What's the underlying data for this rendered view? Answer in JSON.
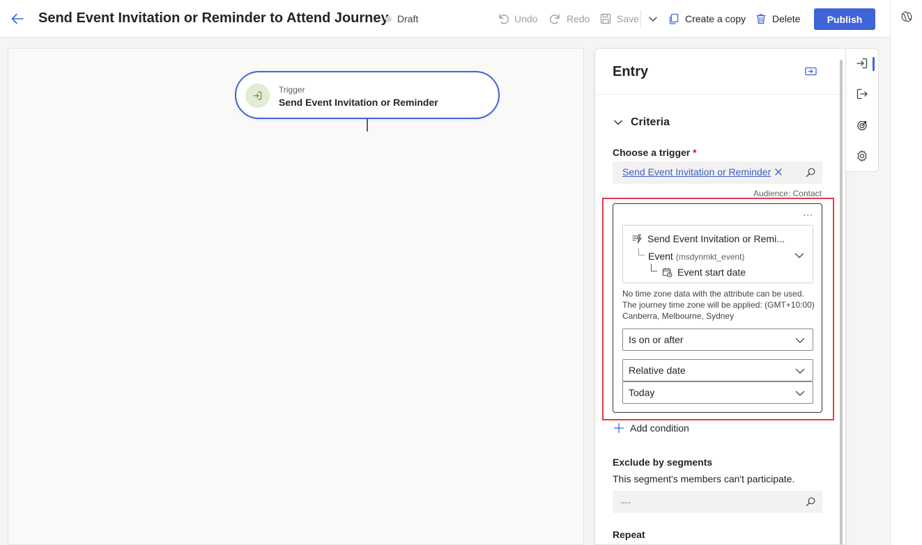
{
  "header": {
    "title": "Send Event Invitation or Reminder to Attend Journey",
    "status": "Draft",
    "undo_label": "Undo",
    "redo_label": "Redo",
    "save_label": "Save",
    "copy_label": "Create a copy",
    "delete_label": "Delete",
    "publish_label": "Publish"
  },
  "canvas": {
    "trigger_small": "Trigger",
    "trigger_name": "Send Event Invitation or Reminder"
  },
  "panel": {
    "title": "Entry",
    "criteria_label": "Criteria",
    "choose_trigger_label": "Choose a trigger",
    "required_mark": "*",
    "trigger_value": "Send Event Invitation or Reminder",
    "audience": "Audience: Contact",
    "condition": {
      "more": "...",
      "attr_source": "Send Event Invitation or Remi...",
      "attr_entity": "Event",
      "attr_entity_sub": "(msdynmkt_event)",
      "attr_field": "Event start date",
      "tz_note": "No time zone data with the attribute can be used. The journey time zone will be applied: (GMT+10:00) Canberra, Melbourne, Sydney",
      "operator": "Is on or after",
      "date_type": "Relative date",
      "date_value": "Today"
    },
    "add_condition_label": "Add condition",
    "exclude_title": "Exclude by segments",
    "exclude_desc": "This segment's members can't participate.",
    "exclude_placeholder": "---",
    "repeat_title": "Repeat"
  },
  "colors": {
    "accent": "#3f64d8",
    "highlight": "#e33b44",
    "trigger_icon_bg": "#e3ecd3"
  }
}
